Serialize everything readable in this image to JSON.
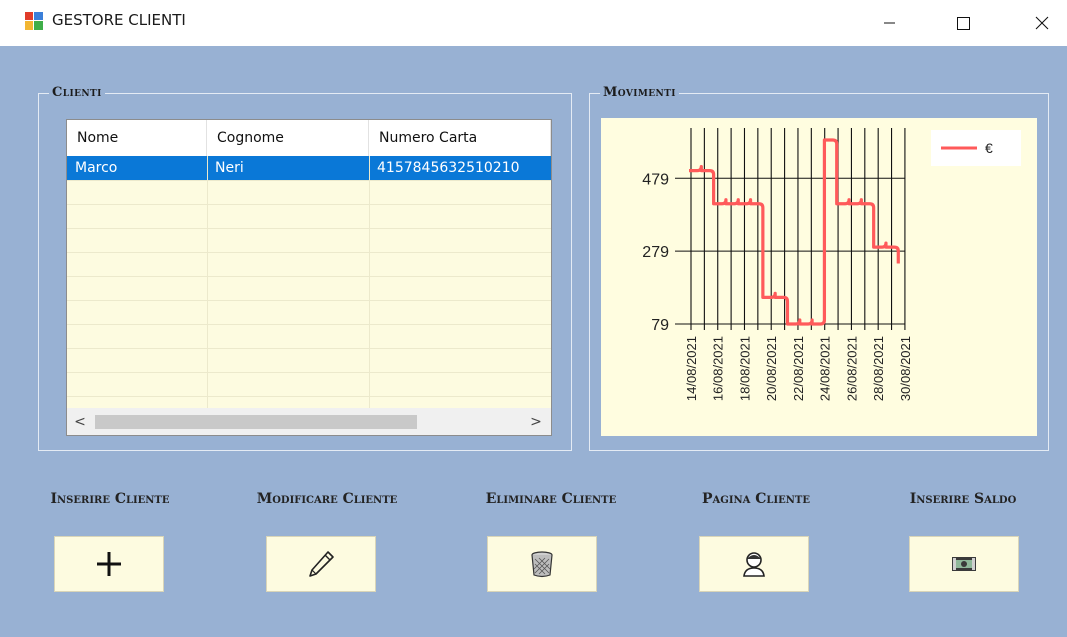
{
  "window": {
    "title": "GESTORE CLIENTI",
    "icon": "app-window-icon",
    "minimize_glyph": "—",
    "maximize_glyph": "☐",
    "close_glyph": "✕"
  },
  "clienti": {
    "group_title": "Clienti",
    "columns": [
      "Nome",
      "Cognome",
      "Numero Carta"
    ],
    "rows": [
      {
        "nome": "Marco",
        "cognome": "Neri",
        "numero_carta": "4157845632510210",
        "selected": true
      }
    ],
    "scroll_left": "<",
    "scroll_right": ">"
  },
  "movimenti": {
    "group_title": "Movimenti",
    "chart_data": {
      "type": "line",
      "x": [
        "14/08/2021",
        "15/08/2021",
        "16/08/2021",
        "17/08/2021",
        "18/08/2021",
        "19/08/2021",
        "20/08/2021",
        "21/08/2021",
        "22/08/2021",
        "23/08/2021",
        "24/08/2021",
        "25/08/2021",
        "26/08/2021",
        "27/08/2021",
        "28/08/2021",
        "29/08/2021",
        "30/08/2021"
      ],
      "x_tick_labels": [
        "14/08/2021",
        "16/08/2021",
        "18/08/2021",
        "20/08/2021",
        "22/08/2021",
        "24/08/2021",
        "26/08/2021",
        "28/08/2021",
        "30/08/2021"
      ],
      "series": [
        {
          "name": "€",
          "color": "#ff5a5a",
          "values": [
            500,
            500,
            409,
            409,
            409,
            409,
            152,
            152,
            79,
            79,
            79,
            584,
            409,
            409,
            409,
            290,
            290,
            245
          ],
          "note_x_end": "30/08/2021+"
        }
      ],
      "y_ticks": [
        79,
        279,
        479
      ],
      "ylim": [
        79,
        584
      ],
      "grid": true,
      "legend": "top-right"
    }
  },
  "actions": [
    {
      "label": "Inserire Cliente",
      "icon": "plus-icon"
    },
    {
      "label": "Modificare Cliente",
      "icon": "pencil-icon"
    },
    {
      "label": "Eliminare Cliente",
      "icon": "trash-icon"
    },
    {
      "label": "Pagina Cliente",
      "icon": "user-icon"
    },
    {
      "label": "Inserire Saldo",
      "icon": "money-icon"
    }
  ]
}
